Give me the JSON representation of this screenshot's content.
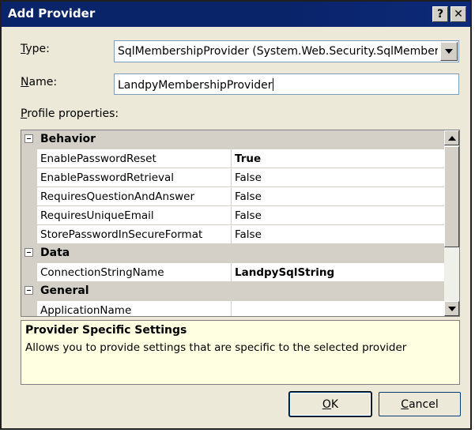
{
  "window": {
    "title": "Add Provider"
  },
  "form": {
    "type_label_first": "T",
    "type_label_rest": "ype:",
    "type_value": "SqlMembershipProvider (System.Web.Security.SqlMembershi",
    "name_label_first": "N",
    "name_label_rest": "ame:",
    "name_value": "LandpyMembershipProvider",
    "profile_label_first": "P",
    "profile_label_rest": "rofile properties:"
  },
  "grid": {
    "categories": [
      {
        "name": "Behavior",
        "props": [
          {
            "name": "EnablePasswordReset",
            "value": "True",
            "bold": true
          },
          {
            "name": "EnablePasswordRetrieval",
            "value": "False"
          },
          {
            "name": "RequiresQuestionAndAnswer",
            "value": "False"
          },
          {
            "name": "RequiresUniqueEmail",
            "value": "False"
          },
          {
            "name": "StorePasswordInSecureFormat",
            "value": "False"
          }
        ]
      },
      {
        "name": "Data",
        "props": [
          {
            "name": "ConnectionStringName",
            "value": "LandpySqlString",
            "bold": true
          }
        ]
      },
      {
        "name": "General",
        "props": [
          {
            "name": "ApplicationName",
            "value": ""
          }
        ]
      }
    ]
  },
  "description": {
    "title": "Provider Specific Settings",
    "text": "Allows you to provide settings that are specific to the selected provider"
  },
  "buttons": {
    "ok_first": "O",
    "ok_rest": "K",
    "cancel_first": "C",
    "cancel_rest": "ancel"
  },
  "icons": {
    "help": "?",
    "close": "✕"
  }
}
